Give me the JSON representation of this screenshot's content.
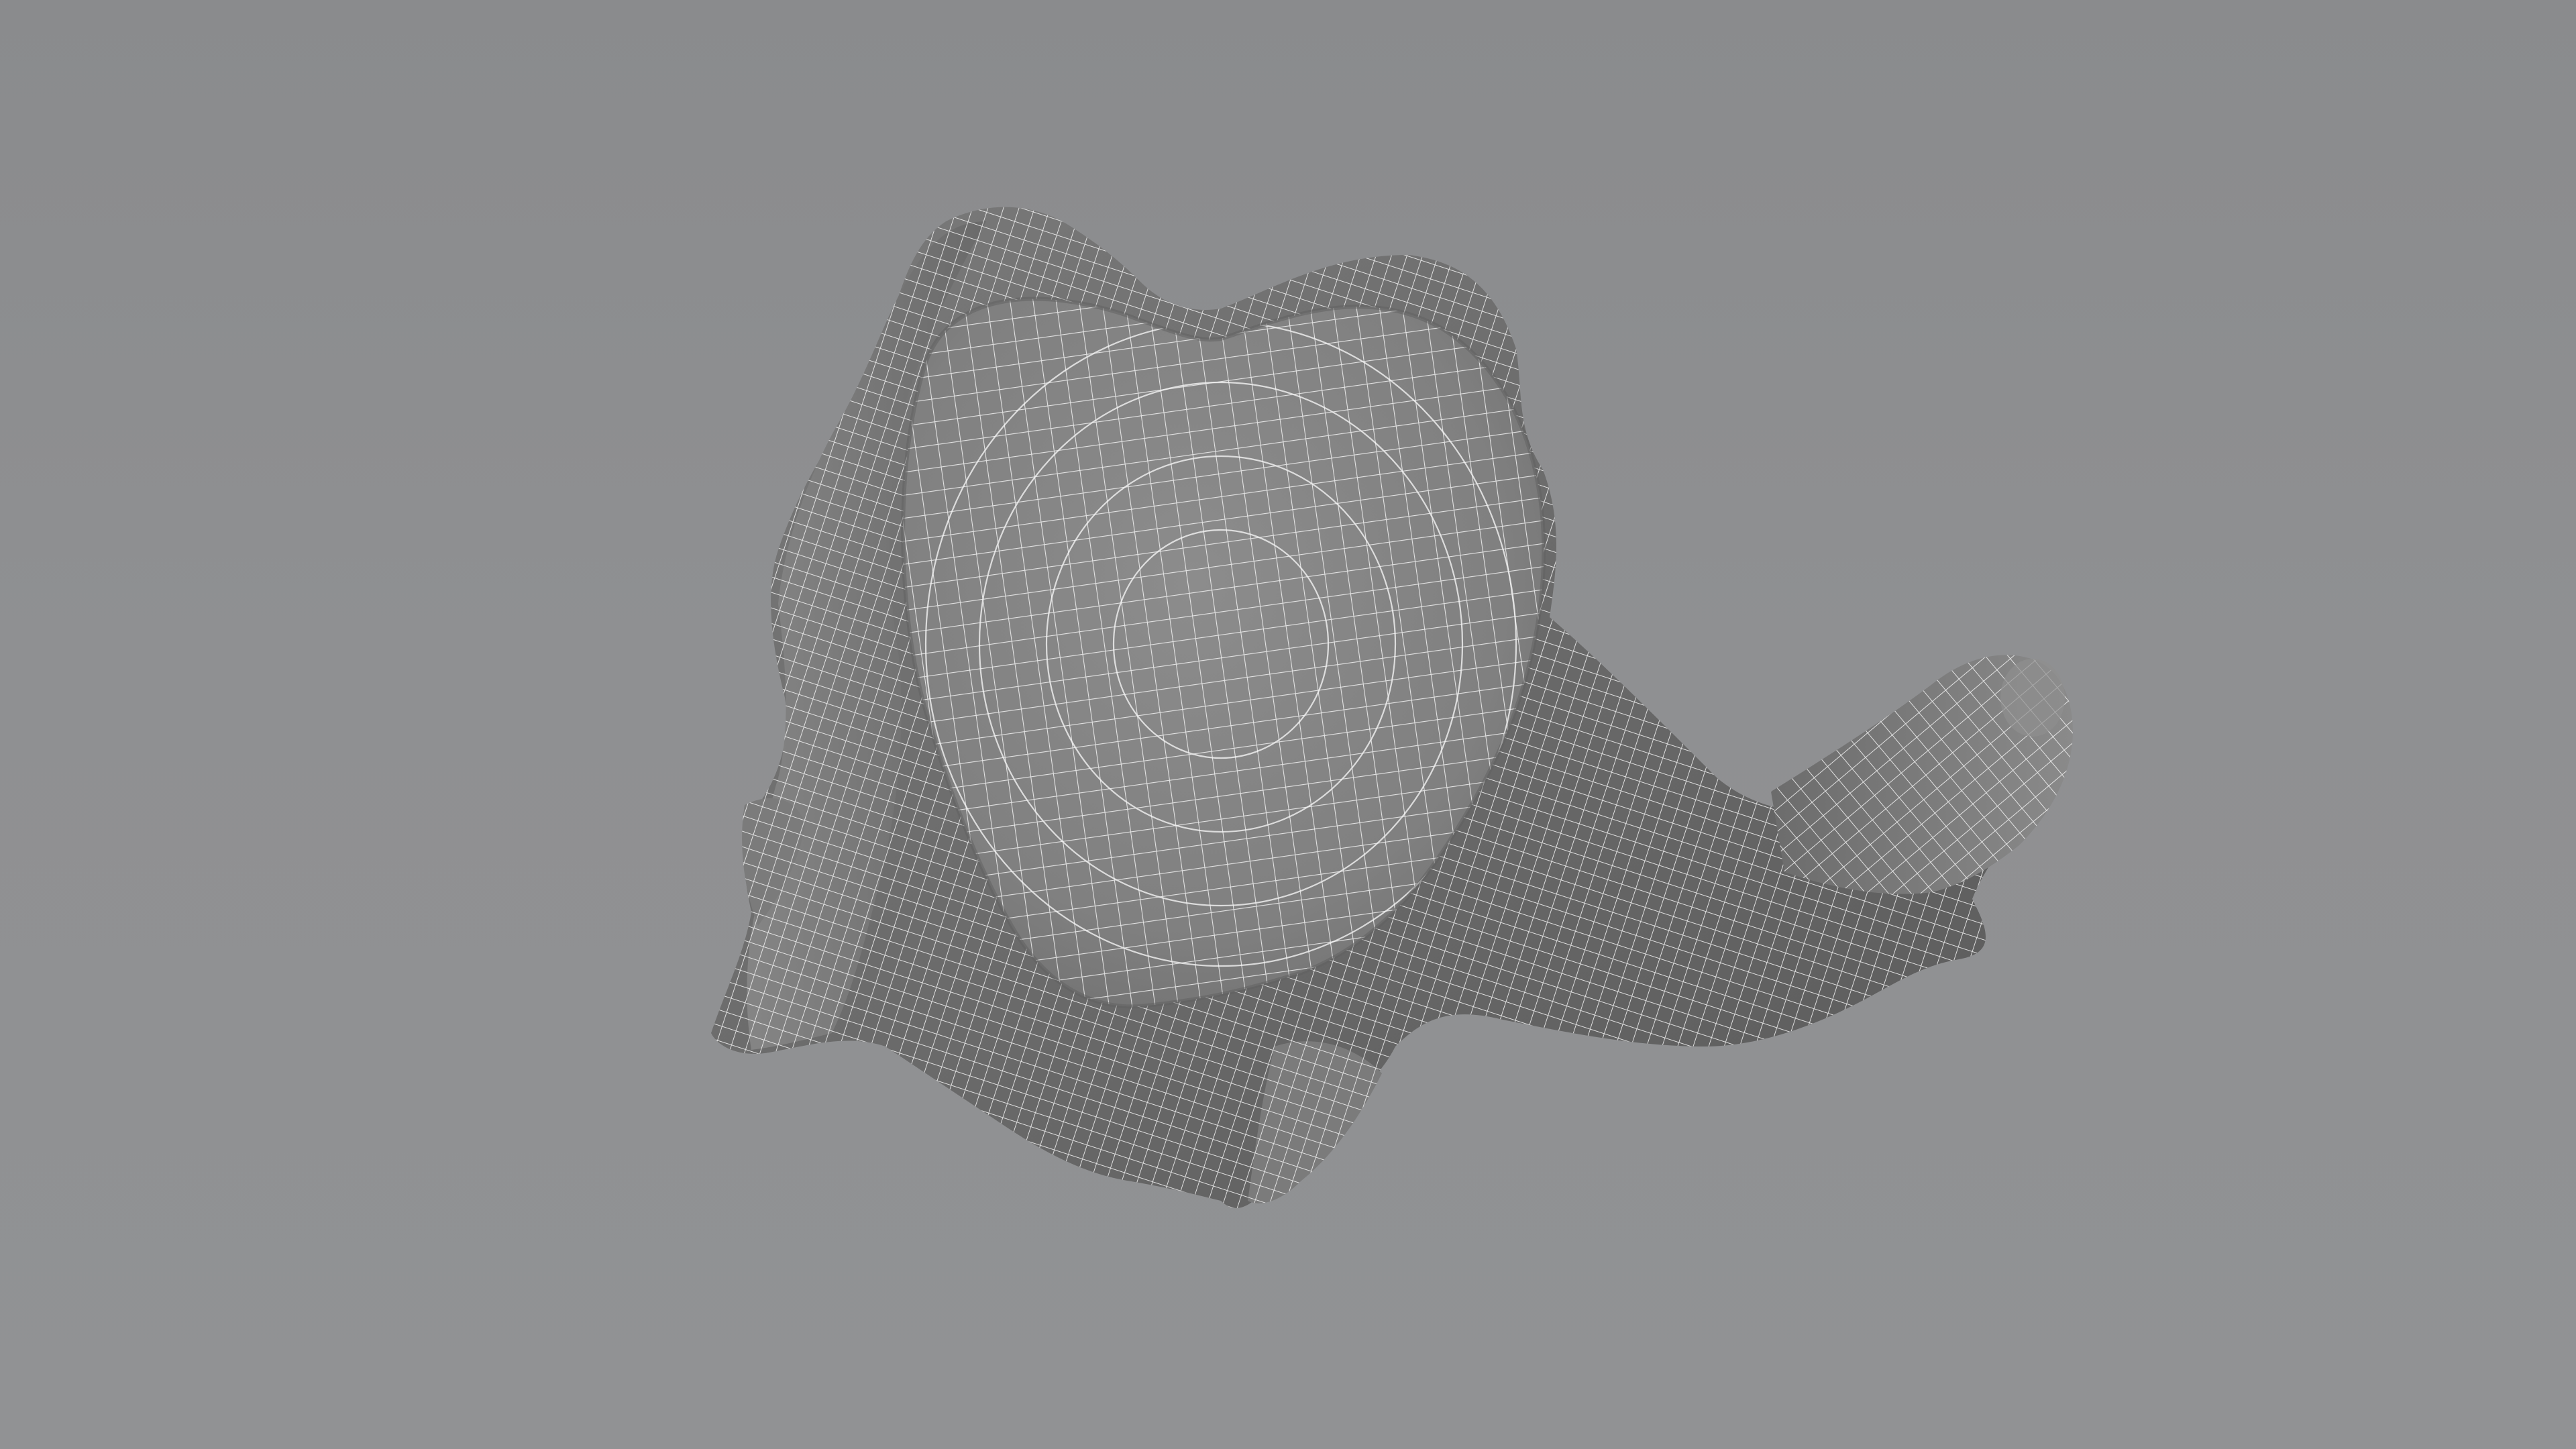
{
  "viewport": {
    "background_color": "#8e8f91",
    "object": "wireframe-mesh-model",
    "mesh_color": "#8a8a8a",
    "wire_color": "#f2f2f2"
  }
}
